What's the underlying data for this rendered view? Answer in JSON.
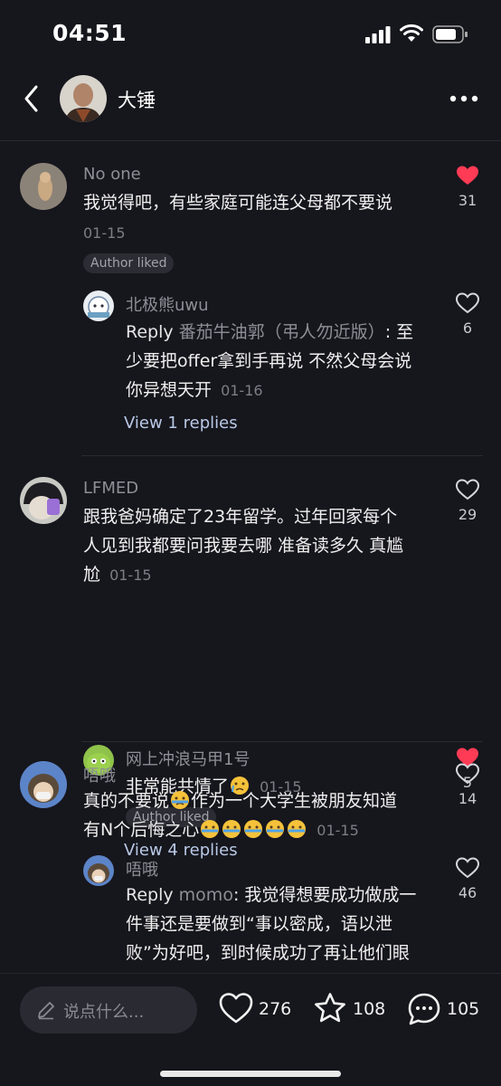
{
  "status": {
    "time": "04:51"
  },
  "header": {
    "title": "大锤"
  },
  "comments": [
    {
      "name": "No one",
      "text": "我觉得吧，有些家庭可能连父母都不要说",
      "date": "01-15",
      "badge": "Author liked",
      "likes": "31",
      "liked": true,
      "reply": {
        "name": "北极熊uwu",
        "reply_word": "Reply",
        "reply_target": "番茄牛油郭（弔人勿近版）",
        "text_line1": ": 至",
        "text_line2": "少要把offer拿到手再说 不然父母会说",
        "text_line3": "你异想天开",
        "date": "01-16",
        "likes": "6",
        "liked": false
      },
      "view_replies": "View 1 replies"
    },
    {
      "name": "LFMED",
      "text_line1": "跟我爸妈确定了23年留学。过年回家每个",
      "text_line2": "人见到我都要问我要去哪 准备读多久 真尴",
      "text_line3": "尬",
      "date": "01-15",
      "likes": "29",
      "liked": false,
      "reply": {
        "name": "网上冲浪马甲1号",
        "text": "非常能共情了",
        "date": "01-15",
        "badge": "Author liked",
        "likes": "5",
        "liked": true
      },
      "view_replies": "View 4 replies"
    },
    {
      "name": "唔哦",
      "text_line1a": "真的不要说",
      "text_line1b": "作为一个大学生被朋友知道",
      "text_line2": "有N个后悔之心",
      "date": "01-15",
      "likes": "14",
      "liked": false,
      "reply": {
        "name": "唔哦",
        "reply_word": "Reply",
        "reply_target": "momo",
        "text_line1": ": 我觉得想要成功做成一",
        "text_line2": "件事还是要做到“事以密成，语以泄",
        "text_line3": "败”为好吧，到时候成功了再让他们眼",
        "likes": "46",
        "liked": false
      }
    }
  ],
  "bottom": {
    "placeholder": "说点什么...",
    "likes": "276",
    "favorites": "108",
    "comments": "105"
  },
  "colors": {
    "background": "#16161d",
    "liked_red": "#ff3b55",
    "link": "#b9c9e6"
  }
}
